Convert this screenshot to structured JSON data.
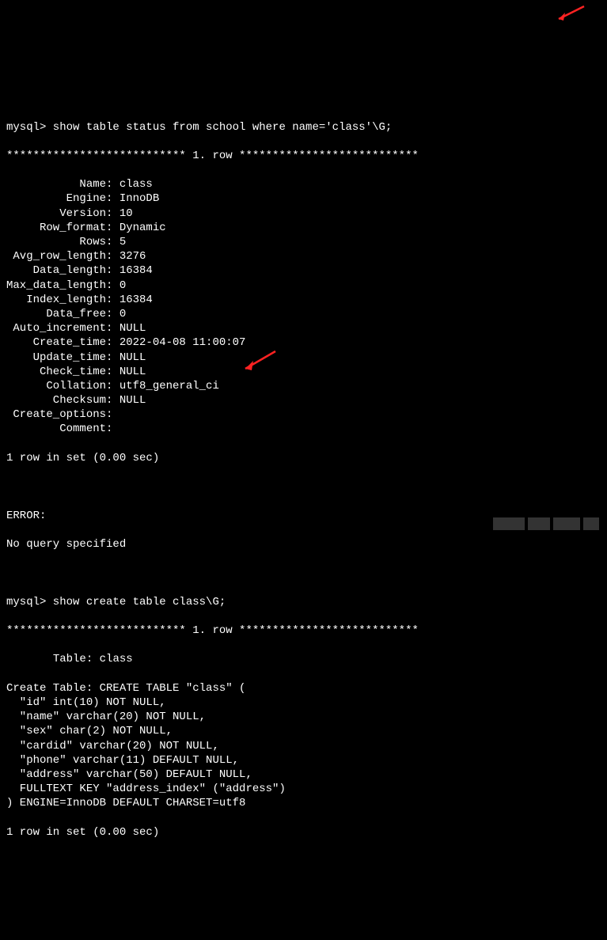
{
  "prompt1": "mysql> show table status from school where name='class'\\G;",
  "row_header1": "*************************** 1. row ***************************",
  "status_fields": [
    {
      "key": "Name",
      "val": "class"
    },
    {
      "key": "Engine",
      "val": "InnoDB"
    },
    {
      "key": "Version",
      "val": "10"
    },
    {
      "key": "Row_format",
      "val": "Dynamic"
    },
    {
      "key": "Rows",
      "val": "5"
    },
    {
      "key": "Avg_row_length",
      "val": "3276"
    },
    {
      "key": "Data_length",
      "val": "16384"
    },
    {
      "key": "Max_data_length",
      "val": "0"
    },
    {
      "key": "Index_length",
      "val": "16384"
    },
    {
      "key": "Data_free",
      "val": "0"
    },
    {
      "key": "Auto_increment",
      "val": "NULL"
    },
    {
      "key": "Create_time",
      "val": "2022-04-08 11:00:07"
    },
    {
      "key": "Update_time",
      "val": "NULL"
    },
    {
      "key": "Check_time",
      "val": "NULL"
    },
    {
      "key": "Collation",
      "val": "utf8_general_ci"
    },
    {
      "key": "Checksum",
      "val": "NULL"
    },
    {
      "key": "Create_options",
      "val": ""
    },
    {
      "key": "Comment",
      "val": ""
    }
  ],
  "result1": "1 row in set (0.00 sec)",
  "error_label": "ERROR:",
  "error_msg": "No query specified",
  "prompt2": "mysql> show create table class\\G;",
  "row_header2": "*************************** 1. row ***************************",
  "table_label_key": "Table",
  "table_label_val": "class",
  "create_table_key": "Create Table",
  "create_table_lines": [
    "CREATE TABLE \"class\" (",
    "  \"id\" int(10) NOT NULL,",
    "  \"name\" varchar(20) NOT NULL,",
    "  \"sex\" char(2) NOT NULL,",
    "  \"cardid\" varchar(20) NOT NULL,",
    "  \"phone\" varchar(11) DEFAULT NULL,",
    "  \"address\" varchar(50) DEFAULT NULL,",
    "  FULLTEXT KEY \"address_index\" (\"address\")",
    ") ENGINE=InnoDB DEFAULT CHARSET=utf8"
  ],
  "result2": "1 row in set (0.00 sec)"
}
